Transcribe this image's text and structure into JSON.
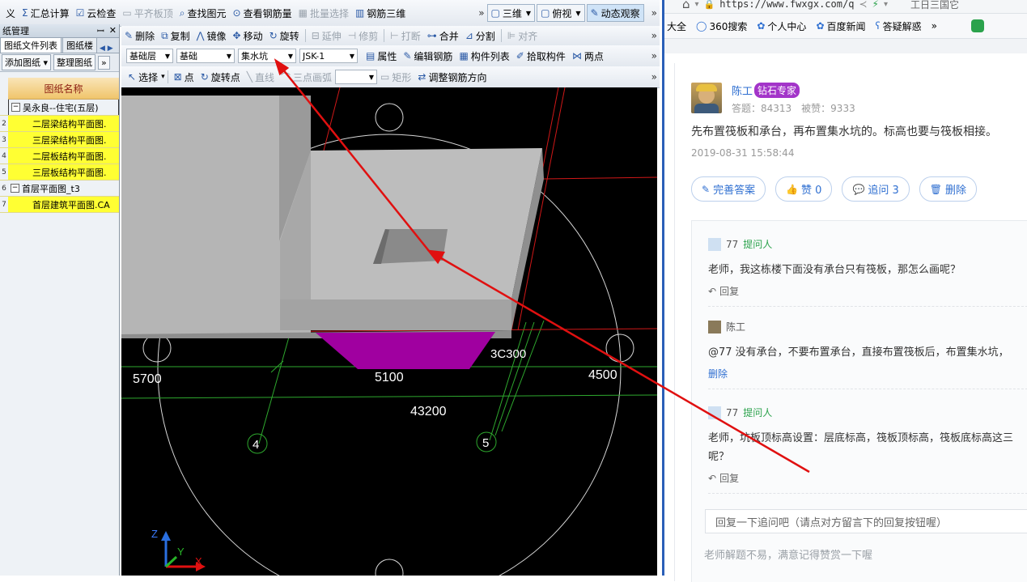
{
  "app": {
    "main_toolbar": [
      {
        "icon": "",
        "label": "义",
        "disabled": false
      },
      {
        "icon": "Σ",
        "label": "汇总计算",
        "disabled": false
      },
      {
        "icon": "☑",
        "label": "云检查",
        "disabled": false
      },
      {
        "icon": "▭",
        "label": "平齐板顶",
        "disabled": true
      },
      {
        "icon": "⌕",
        "label": "查找图元",
        "disabled": false
      },
      {
        "icon": "⊙",
        "label": "查看钢筋量",
        "disabled": false
      },
      {
        "icon": "▦",
        "label": "批量选择",
        "disabled": true
      },
      {
        "icon": "▥",
        "label": "钢筋三维",
        "disabled": false
      }
    ],
    "view_toolbar": [
      {
        "icon": "▢",
        "label": "三维"
      },
      {
        "icon": "▢",
        "label": "俯视"
      },
      {
        "icon": "✎",
        "label": "动态观察"
      }
    ],
    "edit_toolbar": [
      {
        "icon": "✎",
        "label": "删除",
        "disabled": false
      },
      {
        "icon": "⧉",
        "label": "复制",
        "disabled": false
      },
      {
        "icon": "⋀",
        "label": "镜像",
        "disabled": false
      },
      {
        "icon": "✥",
        "label": "移动",
        "disabled": false
      },
      {
        "icon": "↻",
        "label": "旋转",
        "disabled": false
      },
      {
        "icon": "⊟",
        "label": "延伸",
        "disabled": true
      },
      {
        "icon": "⊣",
        "label": "修剪",
        "disabled": true
      },
      {
        "icon": "⊢",
        "label": "打断",
        "disabled": true
      },
      {
        "icon": "⊶",
        "label": "合并",
        "disabled": false
      },
      {
        "icon": "⊿",
        "label": "分割",
        "disabled": false
      },
      {
        "icon": "⊫",
        "label": "对齐",
        "disabled": true
      }
    ],
    "prop_toolbar": {
      "combos": [
        "基础层",
        "基础",
        "集水坑",
        "JSK-1"
      ],
      "buttons": [
        {
          "icon": "▤",
          "label": "属性"
        },
        {
          "icon": "✎",
          "label": "编辑钢筋"
        },
        {
          "icon": "▦",
          "label": "构件列表"
        },
        {
          "icon": "✐",
          "label": "拾取构件"
        },
        {
          "icon": "⋈",
          "label": "两点"
        }
      ]
    },
    "draw_toolbar": [
      {
        "icon": "↖",
        "label": "选择",
        "disabled": false
      },
      {
        "icon": "⊠",
        "label": "点",
        "disabled": false
      },
      {
        "icon": "↻",
        "label": "旋转点",
        "disabled": false
      },
      {
        "icon": "╲",
        "label": "直线",
        "disabled": true
      },
      {
        "icon": "⌒",
        "label": "三点画弧",
        "disabled": true
      },
      {
        "icon": "▭",
        "label": "矩形",
        "disabled": true
      },
      {
        "icon": "⇄",
        "label": "调整钢筋方向",
        "disabled": false
      }
    ],
    "left_panel": {
      "title": "纸管理",
      "pin": "ꟷ",
      "close": "✕",
      "tabs": [
        "图纸文件列表",
        "图纸楼"
      ],
      "buttons": [
        "添加图纸",
        "整理图纸"
      ],
      "table_header": "图纸名称",
      "rows": [
        {
          "idx": "",
          "name": "吴永良--住宅(五层)",
          "group": true,
          "highlight": false
        },
        {
          "idx": "2",
          "name": "二层梁结构平面图.",
          "group": false,
          "highlight": true
        },
        {
          "idx": "3",
          "name": "三层梁结构平面图.",
          "group": false,
          "highlight": true
        },
        {
          "idx": "4",
          "name": "二层板结构平面图.",
          "group": false,
          "highlight": true
        },
        {
          "idx": "5",
          "name": "三层板结构平面图.",
          "group": false,
          "highlight": true
        },
        {
          "idx": "6",
          "name": "首层平面图_t3",
          "group": true,
          "highlight": false
        },
        {
          "idx": "7",
          "name": "首层建筑平面图.CA",
          "group": false,
          "highlight": true
        }
      ]
    },
    "viewport_labels": {
      "dim_5700": "5700",
      "dim_5100": "5100",
      "dim_3c300": "3C300",
      "dim_4500": "4500",
      "dim_43200": "43200",
      "axis_4": "4",
      "axis_5": "5",
      "axis_z": "Z",
      "axis_y": "Y",
      "axis_x": "X"
    }
  },
  "browser": {
    "url": "https://www.fwxgx.com/q",
    "tab_fragment": "工日三国它",
    "bookmarks": [
      {
        "icon": "",
        "label": "大全"
      },
      {
        "icon": "◯",
        "label": "360搜索"
      },
      {
        "icon": "✿",
        "label": "个人中心"
      },
      {
        "icon": "✿",
        "label": "百度新闻"
      },
      {
        "icon": "ʕ",
        "label": "答疑解惑"
      }
    ],
    "answer": {
      "author": "陈工",
      "badge": "钻石专家",
      "stats": "答题：84313　被赞：9333",
      "text": "先布置筏板和承台，再布置集水坑的。标高也要与筏板相接。",
      "time": "2019-08-31 15:58:44",
      "actions": [
        {
          "icon": "✎",
          "label": "完善答案"
        },
        {
          "icon": "👍",
          "label": "赞 0"
        },
        {
          "icon": "💬",
          "label": "追问 3"
        },
        {
          "icon": "🗑",
          "label": "删除"
        }
      ]
    },
    "comments": [
      {
        "name": "77",
        "role": "提问人",
        "text": "老师，我这栋楼下面没有承台只有筏板，那怎么画呢？",
        "action": "回复"
      },
      {
        "name": "陈工",
        "role": "",
        "text": "@77 没有承台，不要布置承台，直接布置筏板后，布置集水坑，",
        "action": "删除"
      },
      {
        "name": "77",
        "role": "提问人",
        "text": "老师，坑板顶标高设置：层底标高，筏板顶标高，筏板底标高这三",
        "text2": "呢？",
        "action": "回复"
      }
    ],
    "reply_placeholder": "回复一下追问吧（请点对方留言下的回复按钮喔）",
    "footer_note": "老师解题不易，满意记得赞赏一下喔"
  },
  "colors": {
    "accent_blue": "#2f6fd1",
    "badge_purple": "#a335c9",
    "annotation_red": "#e01010",
    "pit_purple": "#a000a0",
    "role_green": "#2ba24c"
  }
}
